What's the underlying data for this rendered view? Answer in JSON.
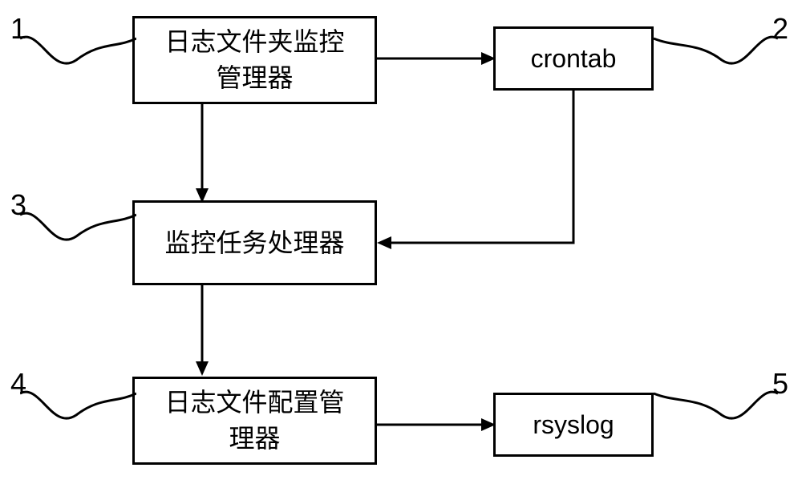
{
  "boxes": {
    "box1": "日志文件夹监控\n管理器",
    "box2": "crontab",
    "box3": "监控任务处理器",
    "box4": "日志文件配置管\n理器",
    "box5": "rsyslog"
  },
  "labels": {
    "n1": "1",
    "n2": "2",
    "n3": "3",
    "n4": "4",
    "n5": "5"
  }
}
